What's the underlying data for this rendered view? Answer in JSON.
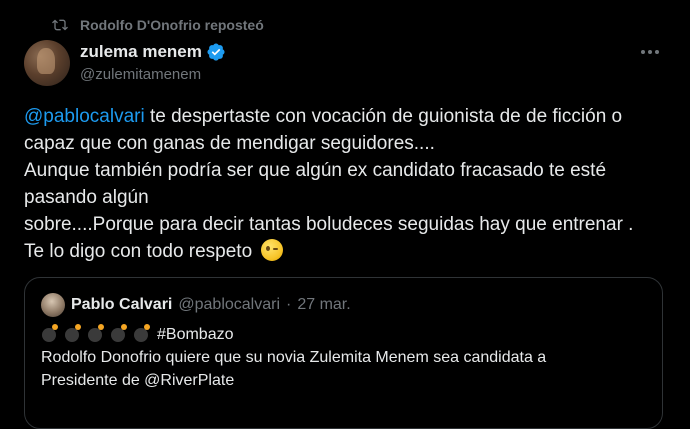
{
  "repost": {
    "icon": "repost-icon",
    "text": "Rodolfo D'Onofrio reposteó"
  },
  "author": {
    "avatar": "avatar",
    "display_name": "zulema menem",
    "verified_icon": "verified-badge-icon",
    "verified_color": "#1d9bf0",
    "handle": "@zulemitamenem"
  },
  "more_icon": "more-options-icon",
  "post": {
    "mention": "@pablocalvari",
    "lines": [
      " te despertaste con vocación de guionista de de ficción o",
      "capaz que con ganas de mendigar seguidores....",
      "Aunque también podría ser que algún ex candidato fracasado te esté",
      "pasando algún",
      "sobre....Porque para decir tantas boludeces seguidas hay que entrenar .",
      "Te lo digo con todo respeto"
    ],
    "emoji": "winking-face-emoji"
  },
  "quote": {
    "display_name": "Pablo Calvari",
    "handle": "@pablocalvari",
    "separator": "·",
    "date": "27 mar.",
    "bomb_emoji_count": 5,
    "hashtag": "#Bombazo",
    "lines": [
      "Rodolfo Donofrio quiere que su novia Zulemita Menem sea candidata a",
      "Presidente de @RiverPlate"
    ]
  },
  "colors": {
    "background": "#000000",
    "text_primary": "#e7e9ea",
    "text_secondary": "#71767b",
    "link": "#1d9bf0",
    "border": "#2f3336"
  }
}
